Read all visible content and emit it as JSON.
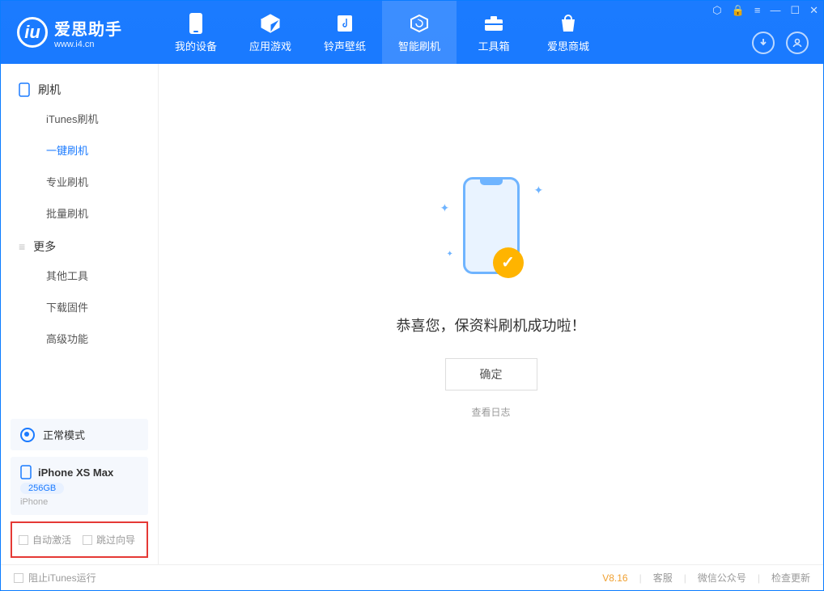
{
  "header": {
    "title": "爱思助手",
    "url": "www.i4.cn",
    "tabs": [
      "我的设备",
      "应用游戏",
      "铃声壁纸",
      "智能刷机",
      "工具箱",
      "爱思商城"
    ]
  },
  "sidebar": {
    "groups": [
      {
        "title": "刷机",
        "items": [
          "iTunes刷机",
          "一键刷机",
          "专业刷机",
          "批量刷机"
        ]
      },
      {
        "title": "更多",
        "items": [
          "其他工具",
          "下载固件",
          "高级功能"
        ]
      }
    ]
  },
  "device": {
    "mode": "正常模式",
    "name": "iPhone XS Max",
    "storage": "256GB",
    "type": "iPhone"
  },
  "options": {
    "auto_activate": "自动激活",
    "skip_guide": "跳过向导"
  },
  "main": {
    "success_message": "恭喜您，保资料刷机成功啦！",
    "ok_button": "确定",
    "view_log": "查看日志"
  },
  "footer": {
    "block_itunes": "阻止iTunes运行",
    "version": "V8.16",
    "links": [
      "客服",
      "微信公众号",
      "检查更新"
    ]
  }
}
